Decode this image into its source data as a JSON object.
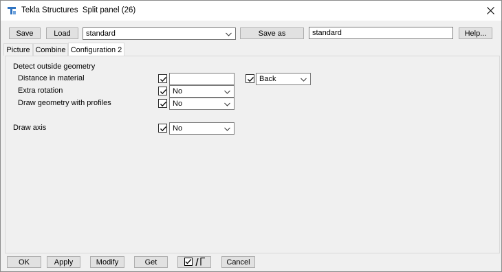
{
  "window": {
    "app_name": "Tekla Structures",
    "dialog_title": "Split panel (26)"
  },
  "toolbar": {
    "save_label": "Save",
    "load_label": "Load",
    "preset_value": "standard",
    "save_as_label": "Save as",
    "save_as_value": "standard",
    "help_label": "Help..."
  },
  "tabs": [
    {
      "label": "Picture",
      "active": false
    },
    {
      "label": "Combine",
      "active": false
    },
    {
      "label": "Configuration 2",
      "active": true
    }
  ],
  "form": {
    "group_title": "Detect outside geometry",
    "distance": {
      "label": "Distance in material",
      "checked": true,
      "value": "",
      "side_checked": true,
      "side_value": "Back"
    },
    "extra_rotation": {
      "label": "Extra rotation",
      "checked": true,
      "value": "No"
    },
    "draw_geometry": {
      "label": "Draw geometry with profiles",
      "checked": true,
      "value": "No"
    },
    "draw_axis": {
      "label": "Draw axis",
      "checked": true,
      "value": "No"
    }
  },
  "bottom": {
    "ok_label": "OK",
    "apply_label": "Apply",
    "modify_label": "Modify",
    "get_label": "Get",
    "cancel_label": "Cancel"
  },
  "colors": {
    "button_bg": "#e1e1e1",
    "dialog_bg": "#f0f0f0",
    "icon_blue": "#2f73c1"
  }
}
